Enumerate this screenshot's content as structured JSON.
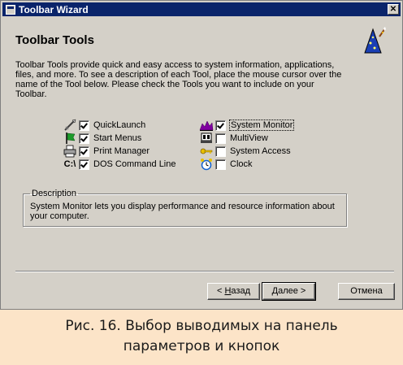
{
  "window": {
    "title": "Toolbar Wizard",
    "close_glyph": "✕"
  },
  "page": {
    "heading": "Toolbar Tools",
    "intro": "Toolbar Tools provide quick and easy access to system information, applications, files, and more.  To see a description of each Tool, place the mouse cursor over the name of the Tool below.  Please check the Tools you want to include on your Toolbar."
  },
  "tools": [
    {
      "label": "QuickLaunch",
      "checked": true,
      "icon": "rocket-icon"
    },
    {
      "label": "Start Menus",
      "checked": true,
      "icon": "green-flag-icon"
    },
    {
      "label": "Print Manager",
      "checked": true,
      "icon": "printer-icon"
    },
    {
      "label": "DOS Command Line",
      "checked": true,
      "icon": "dos-prompt-icon",
      "icon_text": "C:\\"
    },
    {
      "label": "System Monitor",
      "checked": true,
      "icon": "monitor-graph-icon"
    },
    {
      "label": "MultiView",
      "checked": false,
      "icon": "multiview-icon"
    },
    {
      "label": "System Access",
      "checked": false,
      "icon": "key-icon"
    },
    {
      "label": "Clock",
      "checked": false,
      "icon": "alarm-clock-icon"
    }
  ],
  "description": {
    "legend": "Description",
    "text": "System Monitor lets you display performance and resource information about your computer."
  },
  "buttons": {
    "back_prefix": "< ",
    "back_hotkey": "Н",
    "back_rest": "азад",
    "next": "Далее >",
    "cancel": "Отмена"
  },
  "caption": {
    "line1": "Рис. 16. Выбор выводимых на панель",
    "line2": "параметров и кнопок"
  },
  "colors": {
    "titlebar": "#0a246a",
    "dialog_face": "#d4d0c8",
    "caption_background": "#fce4c8"
  }
}
